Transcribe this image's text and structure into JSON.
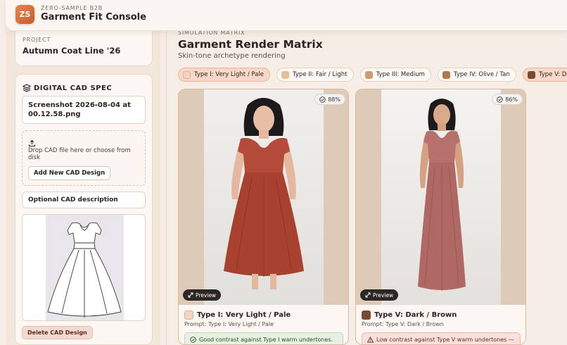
{
  "brand": {
    "subtitle": "ZERO-SAMPLE B2B",
    "title": "Garment Fit Console",
    "logo_initials": "ZS"
  },
  "sidebar": {
    "project": {
      "label": "PROJECT",
      "value": "Autumn Coat Line '26"
    },
    "spec": {
      "title": "DIGITAL CAD SPEC",
      "file_name": "Screenshot 2026-08-04 at 00.12.58.png",
      "drop_text": "Drop CAD file here or choose from disk",
      "add_button": "Add New CAD Design",
      "description_label": "Optional CAD description",
      "delete_button": "Delete CAD Design"
    }
  },
  "main": {
    "section_label": "SIMULATION MATRIX",
    "title": "Garment Render Matrix",
    "subtitle": "Skin-tone archetype rendering",
    "chips": [
      {
        "label": "Type I: Very Light / Pale",
        "color": "#f3d3c1",
        "active": true
      },
      {
        "label": "Type II: Fair / Light",
        "color": "#e7bc9a",
        "active": false
      },
      {
        "label": "Type III: Medium",
        "color": "#cf9b6c",
        "active": false
      },
      {
        "label": "Type IV: Olive / Tan",
        "color": "#b07a4a",
        "active": false
      },
      {
        "label": "Type V: Dark / Brown",
        "color": "#7a4a32",
        "active": true
      }
    ],
    "cards": [
      {
        "match": "88%",
        "preview_label": "Preview",
        "title": "Type I: Very Light / Pale",
        "swatch": "#f3d3c1",
        "prompt": "Prompt: Type I: Very Light / Pale",
        "note": "Good contrast against Type I warm undertones.",
        "note_type": "good",
        "dress_color": "#b34a3a"
      },
      {
        "match": "86%",
        "preview_label": "Preview",
        "title": "Type V: Dark / Brown",
        "swatch": "#7a4a32",
        "prompt": "Prompt: Type V: Dark / Brown",
        "note": "Low contrast against Type V warm undertones —",
        "note_type": "warn",
        "dress_color": "#b7706c"
      }
    ]
  },
  "colors": {
    "accent": "#d9733f",
    "backdrop_light": "#eae9e6",
    "frame": "#ddcbb8"
  }
}
